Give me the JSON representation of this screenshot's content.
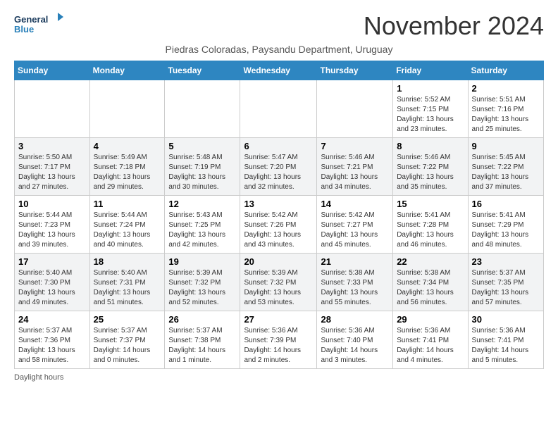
{
  "logo": {
    "line1": "General",
    "line2": "Blue"
  },
  "title": "November 2024",
  "subtitle": "Piedras Coloradas, Paysandu Department, Uruguay",
  "days_of_week": [
    "Sunday",
    "Monday",
    "Tuesday",
    "Wednesday",
    "Thursday",
    "Friday",
    "Saturday"
  ],
  "footer": "Daylight hours",
  "weeks": [
    [
      {
        "day": "",
        "info": ""
      },
      {
        "day": "",
        "info": ""
      },
      {
        "day": "",
        "info": ""
      },
      {
        "day": "",
        "info": ""
      },
      {
        "day": "",
        "info": ""
      },
      {
        "day": "1",
        "info": "Sunrise: 5:52 AM\nSunset: 7:15 PM\nDaylight: 13 hours and 23 minutes."
      },
      {
        "day": "2",
        "info": "Sunrise: 5:51 AM\nSunset: 7:16 PM\nDaylight: 13 hours and 25 minutes."
      }
    ],
    [
      {
        "day": "3",
        "info": "Sunrise: 5:50 AM\nSunset: 7:17 PM\nDaylight: 13 hours and 27 minutes."
      },
      {
        "day": "4",
        "info": "Sunrise: 5:49 AM\nSunset: 7:18 PM\nDaylight: 13 hours and 29 minutes."
      },
      {
        "day": "5",
        "info": "Sunrise: 5:48 AM\nSunset: 7:19 PM\nDaylight: 13 hours and 30 minutes."
      },
      {
        "day": "6",
        "info": "Sunrise: 5:47 AM\nSunset: 7:20 PM\nDaylight: 13 hours and 32 minutes."
      },
      {
        "day": "7",
        "info": "Sunrise: 5:46 AM\nSunset: 7:21 PM\nDaylight: 13 hours and 34 minutes."
      },
      {
        "day": "8",
        "info": "Sunrise: 5:46 AM\nSunset: 7:22 PM\nDaylight: 13 hours and 35 minutes."
      },
      {
        "day": "9",
        "info": "Sunrise: 5:45 AM\nSunset: 7:22 PM\nDaylight: 13 hours and 37 minutes."
      }
    ],
    [
      {
        "day": "10",
        "info": "Sunrise: 5:44 AM\nSunset: 7:23 PM\nDaylight: 13 hours and 39 minutes."
      },
      {
        "day": "11",
        "info": "Sunrise: 5:44 AM\nSunset: 7:24 PM\nDaylight: 13 hours and 40 minutes."
      },
      {
        "day": "12",
        "info": "Sunrise: 5:43 AM\nSunset: 7:25 PM\nDaylight: 13 hours and 42 minutes."
      },
      {
        "day": "13",
        "info": "Sunrise: 5:42 AM\nSunset: 7:26 PM\nDaylight: 13 hours and 43 minutes."
      },
      {
        "day": "14",
        "info": "Sunrise: 5:42 AM\nSunset: 7:27 PM\nDaylight: 13 hours and 45 minutes."
      },
      {
        "day": "15",
        "info": "Sunrise: 5:41 AM\nSunset: 7:28 PM\nDaylight: 13 hours and 46 minutes."
      },
      {
        "day": "16",
        "info": "Sunrise: 5:41 AM\nSunset: 7:29 PM\nDaylight: 13 hours and 48 minutes."
      }
    ],
    [
      {
        "day": "17",
        "info": "Sunrise: 5:40 AM\nSunset: 7:30 PM\nDaylight: 13 hours and 49 minutes."
      },
      {
        "day": "18",
        "info": "Sunrise: 5:40 AM\nSunset: 7:31 PM\nDaylight: 13 hours and 51 minutes."
      },
      {
        "day": "19",
        "info": "Sunrise: 5:39 AM\nSunset: 7:32 PM\nDaylight: 13 hours and 52 minutes."
      },
      {
        "day": "20",
        "info": "Sunrise: 5:39 AM\nSunset: 7:32 PM\nDaylight: 13 hours and 53 minutes."
      },
      {
        "day": "21",
        "info": "Sunrise: 5:38 AM\nSunset: 7:33 PM\nDaylight: 13 hours and 55 minutes."
      },
      {
        "day": "22",
        "info": "Sunrise: 5:38 AM\nSunset: 7:34 PM\nDaylight: 13 hours and 56 minutes."
      },
      {
        "day": "23",
        "info": "Sunrise: 5:37 AM\nSunset: 7:35 PM\nDaylight: 13 hours and 57 minutes."
      }
    ],
    [
      {
        "day": "24",
        "info": "Sunrise: 5:37 AM\nSunset: 7:36 PM\nDaylight: 13 hours and 58 minutes."
      },
      {
        "day": "25",
        "info": "Sunrise: 5:37 AM\nSunset: 7:37 PM\nDaylight: 14 hours and 0 minutes."
      },
      {
        "day": "26",
        "info": "Sunrise: 5:37 AM\nSunset: 7:38 PM\nDaylight: 14 hours and 1 minute."
      },
      {
        "day": "27",
        "info": "Sunrise: 5:36 AM\nSunset: 7:39 PM\nDaylight: 14 hours and 2 minutes."
      },
      {
        "day": "28",
        "info": "Sunrise: 5:36 AM\nSunset: 7:40 PM\nDaylight: 14 hours and 3 minutes."
      },
      {
        "day": "29",
        "info": "Sunrise: 5:36 AM\nSunset: 7:41 PM\nDaylight: 14 hours and 4 minutes."
      },
      {
        "day": "30",
        "info": "Sunrise: 5:36 AM\nSunset: 7:41 PM\nDaylight: 14 hours and 5 minutes."
      }
    ]
  ]
}
